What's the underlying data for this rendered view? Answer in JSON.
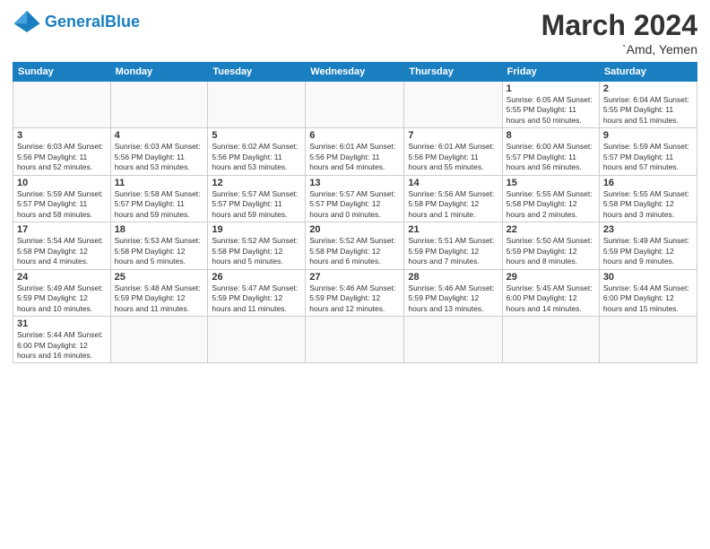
{
  "header": {
    "logo_general": "General",
    "logo_blue": "Blue",
    "title": "March 2024",
    "subtitle": "`Amd, Yemen"
  },
  "days_of_week": [
    "Sunday",
    "Monday",
    "Tuesday",
    "Wednesday",
    "Thursday",
    "Friday",
    "Saturday"
  ],
  "weeks": [
    [
      {
        "day": "",
        "info": ""
      },
      {
        "day": "",
        "info": ""
      },
      {
        "day": "",
        "info": ""
      },
      {
        "day": "",
        "info": ""
      },
      {
        "day": "",
        "info": ""
      },
      {
        "day": "1",
        "info": "Sunrise: 6:05 AM\nSunset: 5:55 PM\nDaylight: 11 hours\nand 50 minutes."
      },
      {
        "day": "2",
        "info": "Sunrise: 6:04 AM\nSunset: 5:55 PM\nDaylight: 11 hours\nand 51 minutes."
      }
    ],
    [
      {
        "day": "3",
        "info": "Sunrise: 6:03 AM\nSunset: 5:56 PM\nDaylight: 11 hours\nand 52 minutes."
      },
      {
        "day": "4",
        "info": "Sunrise: 6:03 AM\nSunset: 5:56 PM\nDaylight: 11 hours\nand 53 minutes."
      },
      {
        "day": "5",
        "info": "Sunrise: 6:02 AM\nSunset: 5:56 PM\nDaylight: 11 hours\nand 53 minutes."
      },
      {
        "day": "6",
        "info": "Sunrise: 6:01 AM\nSunset: 5:56 PM\nDaylight: 11 hours\nand 54 minutes."
      },
      {
        "day": "7",
        "info": "Sunrise: 6:01 AM\nSunset: 5:56 PM\nDaylight: 11 hours\nand 55 minutes."
      },
      {
        "day": "8",
        "info": "Sunrise: 6:00 AM\nSunset: 5:57 PM\nDaylight: 11 hours\nand 56 minutes."
      },
      {
        "day": "9",
        "info": "Sunrise: 5:59 AM\nSunset: 5:57 PM\nDaylight: 11 hours\nand 57 minutes."
      }
    ],
    [
      {
        "day": "10",
        "info": "Sunrise: 5:59 AM\nSunset: 5:57 PM\nDaylight: 11 hours\nand 58 minutes."
      },
      {
        "day": "11",
        "info": "Sunrise: 5:58 AM\nSunset: 5:57 PM\nDaylight: 11 hours\nand 59 minutes."
      },
      {
        "day": "12",
        "info": "Sunrise: 5:57 AM\nSunset: 5:57 PM\nDaylight: 11 hours\nand 59 minutes."
      },
      {
        "day": "13",
        "info": "Sunrise: 5:57 AM\nSunset: 5:57 PM\nDaylight: 12 hours\nand 0 minutes."
      },
      {
        "day": "14",
        "info": "Sunrise: 5:56 AM\nSunset: 5:58 PM\nDaylight: 12 hours\nand 1 minute."
      },
      {
        "day": "15",
        "info": "Sunrise: 5:55 AM\nSunset: 5:58 PM\nDaylight: 12 hours\nand 2 minutes."
      },
      {
        "day": "16",
        "info": "Sunrise: 5:55 AM\nSunset: 5:58 PM\nDaylight: 12 hours\nand 3 minutes."
      }
    ],
    [
      {
        "day": "17",
        "info": "Sunrise: 5:54 AM\nSunset: 5:58 PM\nDaylight: 12 hours\nand 4 minutes."
      },
      {
        "day": "18",
        "info": "Sunrise: 5:53 AM\nSunset: 5:58 PM\nDaylight: 12 hours\nand 5 minutes."
      },
      {
        "day": "19",
        "info": "Sunrise: 5:52 AM\nSunset: 5:58 PM\nDaylight: 12 hours\nand 5 minutes."
      },
      {
        "day": "20",
        "info": "Sunrise: 5:52 AM\nSunset: 5:58 PM\nDaylight: 12 hours\nand 6 minutes."
      },
      {
        "day": "21",
        "info": "Sunrise: 5:51 AM\nSunset: 5:59 PM\nDaylight: 12 hours\nand 7 minutes."
      },
      {
        "day": "22",
        "info": "Sunrise: 5:50 AM\nSunset: 5:59 PM\nDaylight: 12 hours\nand 8 minutes."
      },
      {
        "day": "23",
        "info": "Sunrise: 5:49 AM\nSunset: 5:59 PM\nDaylight: 12 hours\nand 9 minutes."
      }
    ],
    [
      {
        "day": "24",
        "info": "Sunrise: 5:49 AM\nSunset: 5:59 PM\nDaylight: 12 hours\nand 10 minutes."
      },
      {
        "day": "25",
        "info": "Sunrise: 5:48 AM\nSunset: 5:59 PM\nDaylight: 12 hours\nand 11 minutes."
      },
      {
        "day": "26",
        "info": "Sunrise: 5:47 AM\nSunset: 5:59 PM\nDaylight: 12 hours\nand 11 minutes."
      },
      {
        "day": "27",
        "info": "Sunrise: 5:46 AM\nSunset: 5:59 PM\nDaylight: 12 hours\nand 12 minutes."
      },
      {
        "day": "28",
        "info": "Sunrise: 5:46 AM\nSunset: 5:59 PM\nDaylight: 12 hours\nand 13 minutes."
      },
      {
        "day": "29",
        "info": "Sunrise: 5:45 AM\nSunset: 6:00 PM\nDaylight: 12 hours\nand 14 minutes."
      },
      {
        "day": "30",
        "info": "Sunrise: 5:44 AM\nSunset: 6:00 PM\nDaylight: 12 hours\nand 15 minutes."
      }
    ],
    [
      {
        "day": "31",
        "info": "Sunrise: 5:44 AM\nSunset: 6:00 PM\nDaylight: 12 hours\nand 16 minutes."
      },
      {
        "day": "",
        "info": ""
      },
      {
        "day": "",
        "info": ""
      },
      {
        "day": "",
        "info": ""
      },
      {
        "day": "",
        "info": ""
      },
      {
        "day": "",
        "info": ""
      },
      {
        "day": "",
        "info": ""
      }
    ]
  ]
}
